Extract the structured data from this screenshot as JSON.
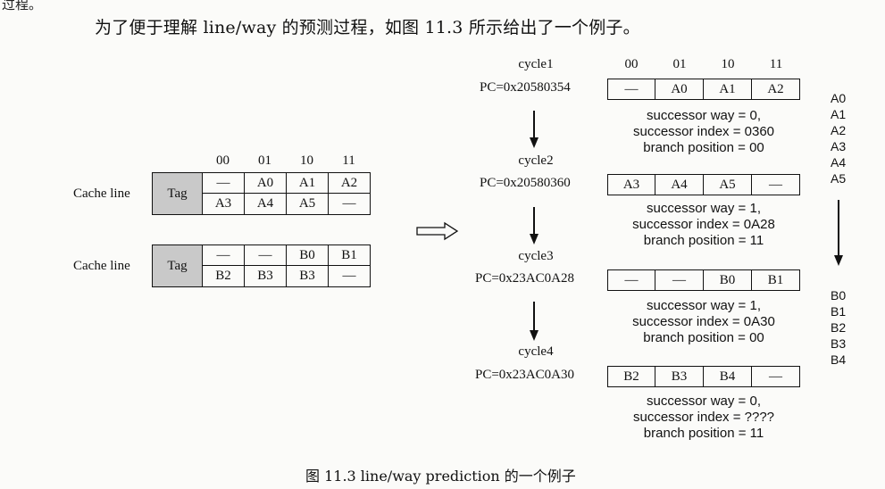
{
  "page": {
    "fragment": "过程。",
    "intro": "为了便于理解 line/way 的预测过程，如图 11.3 所示给出了一个例子。",
    "caption": "图 11.3   line/way prediction 的一个例子"
  },
  "cache": {
    "headers": [
      "00",
      "01",
      "10",
      "11"
    ],
    "tag_label": "Tag",
    "lines": [
      {
        "label": "Cache line",
        "rows": [
          [
            "—",
            "A0",
            "A1",
            "A2"
          ],
          [
            "A3",
            "A4",
            "A5",
            "—"
          ]
        ]
      },
      {
        "label": "Cache line",
        "rows": [
          [
            "—",
            "—",
            "B0",
            "B1"
          ],
          [
            "B2",
            "B3",
            "B3",
            "—"
          ]
        ]
      }
    ]
  },
  "cycles": {
    "headers": [
      "00",
      "01",
      "10",
      "11"
    ],
    "items": [
      {
        "name": "cycle1",
        "pc": "PC=0x20580354",
        "cells": [
          "—",
          "A0",
          "A1",
          "A2"
        ],
        "info": [
          "successor way = 0,",
          "successor index = 0360",
          "branch position = 00"
        ]
      },
      {
        "name": "cycle2",
        "pc": "PC=0x20580360",
        "cells": [
          "A3",
          "A4",
          "A5",
          "—"
        ],
        "info": [
          "successor way = 1,",
          "successor index = 0A28",
          "branch position = 11"
        ]
      },
      {
        "name": "cycle3",
        "pc": "PC=0x23AC0A28",
        "cells": [
          "—",
          "—",
          "B0",
          "B1"
        ],
        "info": [
          "successor way = 1,",
          "successor index = 0A30",
          "branch position = 00"
        ]
      },
      {
        "name": "cycle4",
        "pc": "PC=0x23AC0A30",
        "cells": [
          "B2",
          "B3",
          "B4",
          "—"
        ],
        "info": [
          "successor way = 0,",
          "successor index = ????",
          "branch position = 11"
        ]
      }
    ]
  },
  "sequence": {
    "a": [
      "A0",
      "A1",
      "A2",
      "A3",
      "A4",
      "A5"
    ],
    "b": [
      "B0",
      "B1",
      "B2",
      "B3",
      "B4"
    ]
  }
}
